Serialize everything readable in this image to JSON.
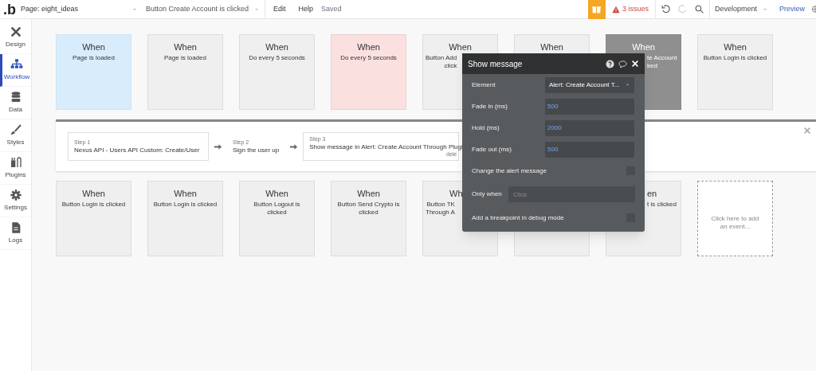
{
  "topbar": {
    "logo": ".b",
    "page_select": "Page: eight_ideas",
    "event_select": "Button Create Account is clicked",
    "menu": [
      "Edit",
      "Help"
    ],
    "save_status": "Saved",
    "issues": "3 issues",
    "environment": "Development",
    "preview": "Preview"
  },
  "sidebar": {
    "items": [
      {
        "label": "Design",
        "selected": false
      },
      {
        "label": "Workflow",
        "selected": true
      },
      {
        "label": "Data",
        "selected": false
      },
      {
        "label": "Styles",
        "selected": false
      },
      {
        "label": "Plugins",
        "selected": false
      },
      {
        "label": "Settings",
        "selected": false
      },
      {
        "label": "Logs",
        "selected": false
      }
    ]
  },
  "events_top": [
    {
      "title": "When",
      "lines": [
        "Page is loaded"
      ]
    },
    {
      "title": "When",
      "lines": [
        "Page is loaded"
      ]
    },
    {
      "title": "When",
      "lines": [
        "Do every 5 seconds"
      ]
    },
    {
      "title": "When",
      "lines": [
        "Do every 5 seconds"
      ]
    },
    {
      "title": "When",
      "lines": [
        "Button Add",
        "click"
      ]
    },
    {
      "title": "When"
    },
    {
      "title": "When",
      "lines": [
        "te Account",
        "ked"
      ]
    },
    {
      "title": "When",
      "lines": [
        "Button Login is clicked"
      ]
    }
  ],
  "workflow": {
    "steps": [
      {
        "label": "Step 1",
        "text": "Nexus API - Users API Custom: Create/User"
      },
      {
        "label": "Step 2",
        "text": "Sign the user up"
      },
      {
        "label": "Step 3",
        "text": "Show message in Alert: Create Account Through Plugi",
        "note": "dele"
      }
    ]
  },
  "events_bottom": [
    {
      "title": "When",
      "lines": [
        "Button Login is clicked"
      ]
    },
    {
      "title": "When",
      "lines": [
        "Button Login is clicked"
      ]
    },
    {
      "title": "When",
      "lines": [
        "Button Logout is",
        "clicked"
      ]
    },
    {
      "title": "When",
      "lines": [
        "Button Send Crypto is",
        "clicked"
      ]
    },
    {
      "title": "Wh",
      "lines": [
        "Button TK",
        "Through A"
      ]
    },
    {
      "kind": "empty"
    },
    {
      "title": "en",
      "lines": [
        "t is clicked"
      ]
    },
    {
      "kind": "add",
      "lines": [
        "Click here to add an event..."
      ]
    }
  ],
  "popup": {
    "title": "Show message",
    "rows": [
      {
        "kind": "select",
        "label": "Element",
        "value": "Alert: Create Account T..."
      },
      {
        "kind": "input",
        "label": "Fade in (ms)",
        "value": "500"
      },
      {
        "kind": "input",
        "label": "Hold (ms)",
        "value": "2000"
      },
      {
        "kind": "input",
        "label": "Fade out (ms)",
        "value": "500"
      },
      {
        "kind": "checkbox",
        "label": "Change the alert message",
        "checked": false
      },
      {
        "kind": "condition",
        "label": "Only when",
        "placeholder": "Click"
      },
      {
        "kind": "checkbox",
        "label": "Add a breakpoint in debug mode",
        "checked": false
      }
    ]
  }
}
